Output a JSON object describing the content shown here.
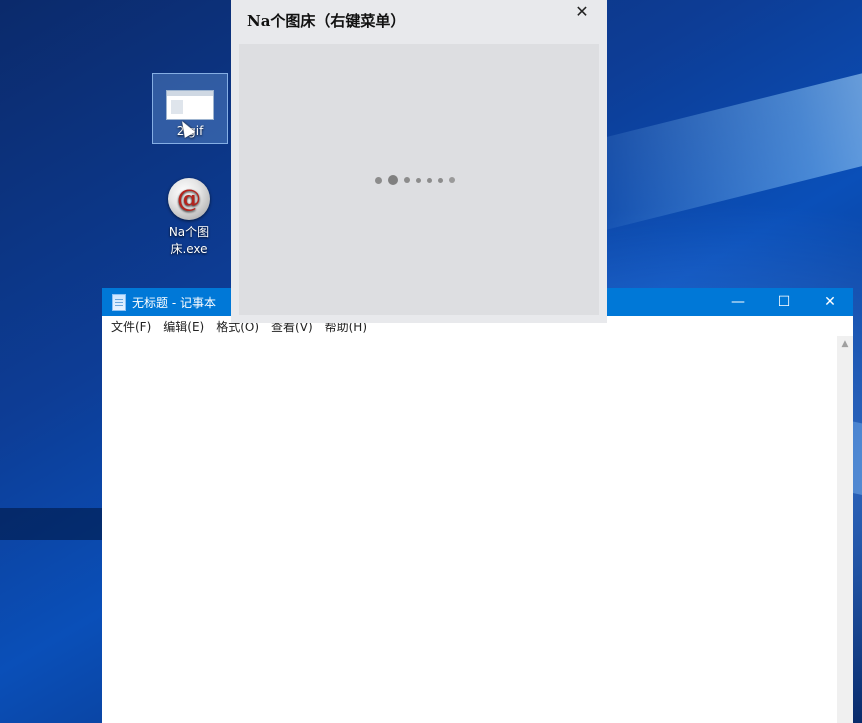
{
  "desktop": {
    "icons": [
      {
        "label": "2.gif",
        "icon": "gif-file-icon"
      },
      {
        "label": "Na个图床.exe",
        "icon": "debian-swirl-app-icon"
      }
    ]
  },
  "dialog": {
    "title": "Na个图床（右键菜单）",
    "close_glyph": "✕",
    "loading_icon": "loading-dots-spinner"
  },
  "notepad": {
    "title": "无标题 - 记事本",
    "controls": {
      "minimize": "—",
      "maximize": "☐",
      "close": "✕"
    },
    "menu": [
      "文件(F)",
      "编辑(E)",
      "格式(O)",
      "查看(V)",
      "帮助(H)"
    ],
    "content": "",
    "scroll_up_glyph": "▲"
  },
  "colors": {
    "titlebar_active": "#0078d7",
    "desktop_blue": "#0d3d96",
    "dialog_bg": "#e8e9ec"
  }
}
